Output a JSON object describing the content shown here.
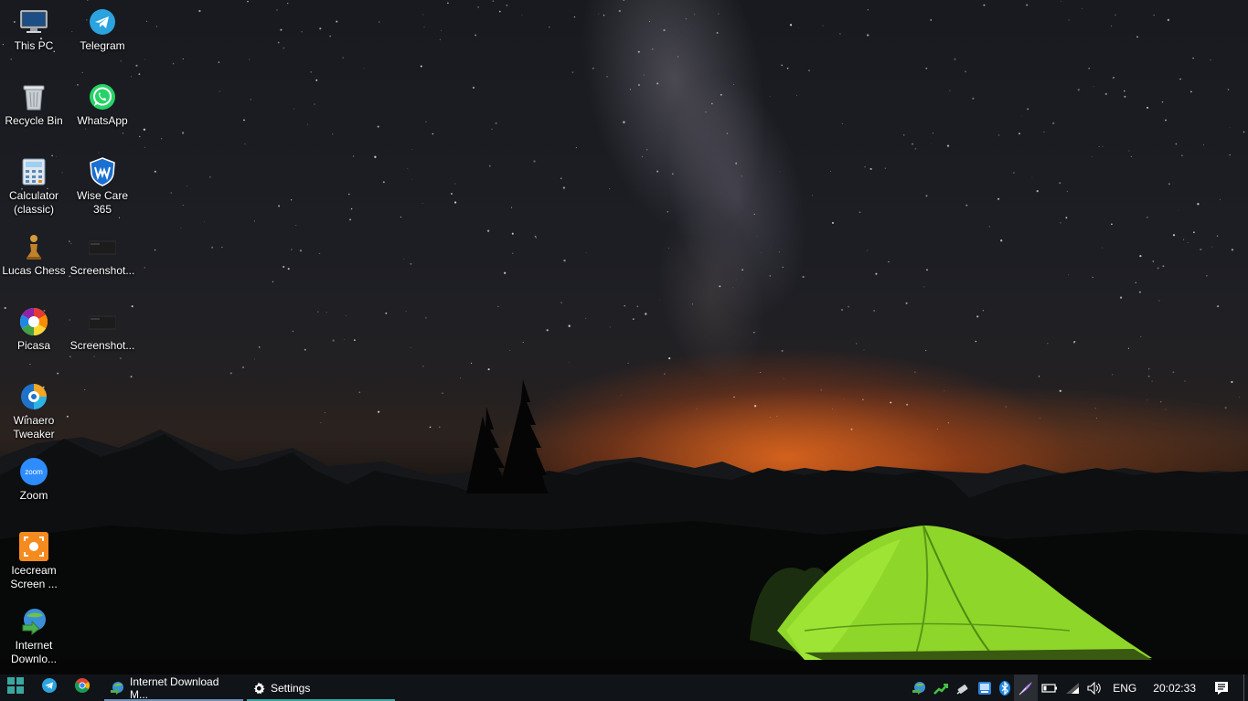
{
  "desktop": {
    "icons": [
      {
        "label": "This PC",
        "icon": "this-pc-icon"
      },
      {
        "label": "Telegram",
        "icon": "telegram-icon"
      },
      {
        "label": "Recycle Bin",
        "icon": "recycle-bin-icon"
      },
      {
        "label": "WhatsApp",
        "icon": "whatsapp-icon"
      },
      {
        "label": "Calculator (classic)",
        "icon": "calculator-icon"
      },
      {
        "label": "Wise Care 365",
        "icon": "wise-care-icon"
      },
      {
        "label": "Lucas Chess",
        "icon": "chess-pawn-icon"
      },
      {
        "label": "Screenshot...",
        "icon": "screenshot-file-icon"
      },
      {
        "label": "Picasa",
        "icon": "picasa-icon"
      },
      {
        "label": "Screenshot...",
        "icon": "screenshot-file-icon"
      },
      {
        "label": "Winaero Tweaker",
        "icon": "winaero-icon"
      },
      {
        "label": "Zoom",
        "icon": "zoom-icon"
      },
      {
        "label": "Icecream Screen ...",
        "icon": "icecream-icon"
      },
      {
        "label": "Internet Downlo...",
        "icon": "idm-icon"
      }
    ]
  },
  "taskbar": {
    "start_icon": "start-icon",
    "pinned": [
      {
        "name": "telegram",
        "icon": "telegram-icon"
      },
      {
        "name": "chrome",
        "icon": "chrome-icon"
      }
    ],
    "apps": [
      {
        "label": "Internet Download M...",
        "icon": "idm-icon"
      },
      {
        "label": "Settings",
        "icon": "gear-icon"
      }
    ],
    "tray": {
      "icons": [
        "idm-tray-icon",
        "stock-tray-icon",
        "usb-tray-icon",
        "screen-tray-icon",
        "bluetooth-icon",
        "pen-tray-icon",
        "battery-icon",
        "wifi-icon",
        "volume-icon"
      ],
      "language": "ENG",
      "clock": "20:02:33",
      "notifications_icon": "action-center-icon"
    }
  },
  "colors": {
    "taskbar_bg": "#101317",
    "tent": "#8fd62a",
    "glow": "#e0661e",
    "telegram": "#2aa3df",
    "whatsapp": "#25d366",
    "zoom": "#2d8cff",
    "icecream": "#f58b1f"
  }
}
